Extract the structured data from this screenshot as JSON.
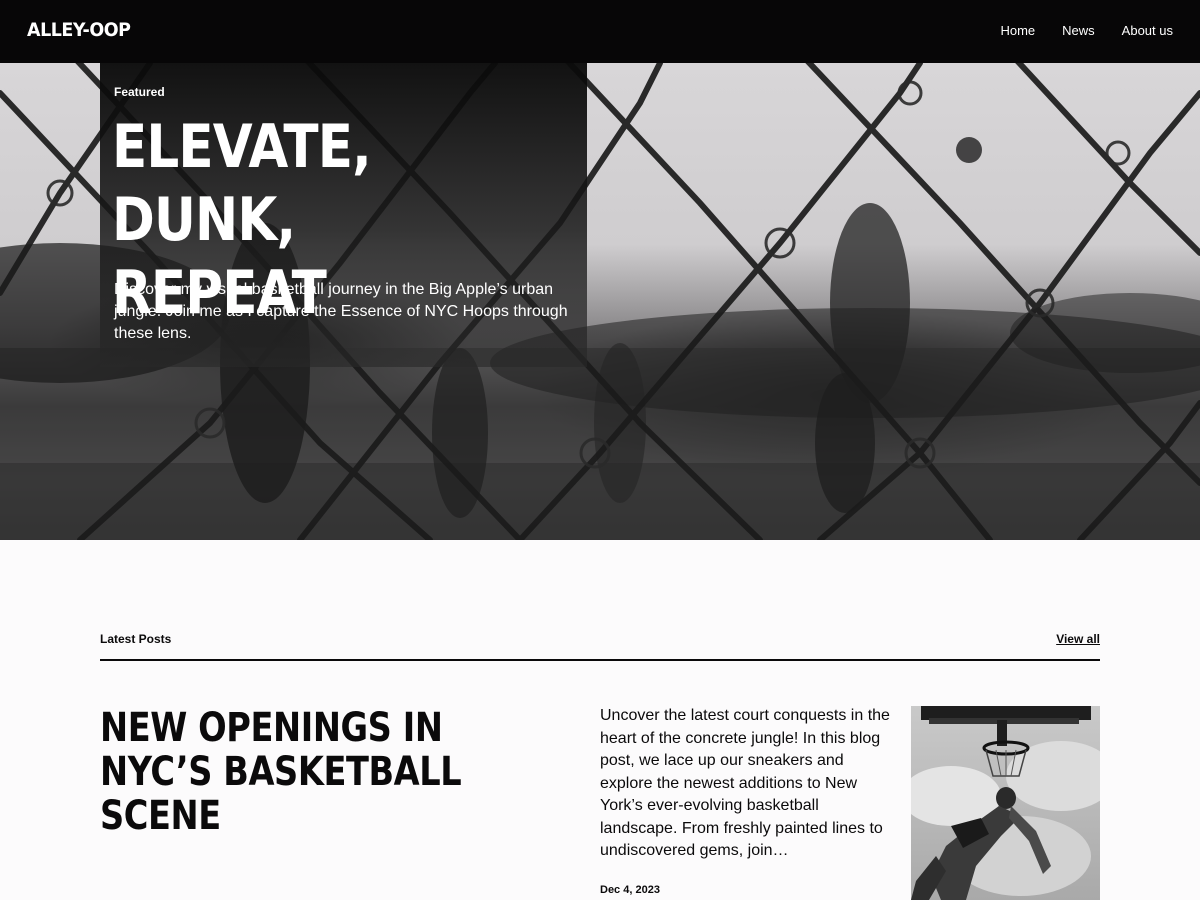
{
  "header": {
    "logo": "ALLEY-OOP",
    "nav": [
      {
        "label": "Home"
      },
      {
        "label": "News"
      },
      {
        "label": "About us"
      }
    ]
  },
  "hero": {
    "label": "Featured",
    "title_line1": "Elevate,",
    "title_line2": "Dunk, Repeat",
    "description": "Discover my visual basketball journey in the Big Apple’s urban jungle. Join me as I capture the Essence of NYC Hoops through these lens.",
    "image_icon": "chain-link-fence-basketball-photo"
  },
  "latest": {
    "heading": "Latest Posts",
    "view_all": "View all",
    "posts": [
      {
        "title": "New Openings in NYC’s Basketball Scene",
        "excerpt": "Uncover the latest court conquests in the heart of the concrete jungle! In this blog post, we lace up our sneakers and explore the newest additions to New York’s ever-evolving basketball landscape. From freshly painted lines to undiscovered gems, join…",
        "date": "Dec 4, 2023",
        "image_icon": "dunk-under-hoop-photo"
      }
    ]
  },
  "colors": {
    "header_bg": "#070607",
    "page_bg": "#fcfbfc",
    "text": "#0b0a0b",
    "inverse_text": "#ffffff"
  }
}
